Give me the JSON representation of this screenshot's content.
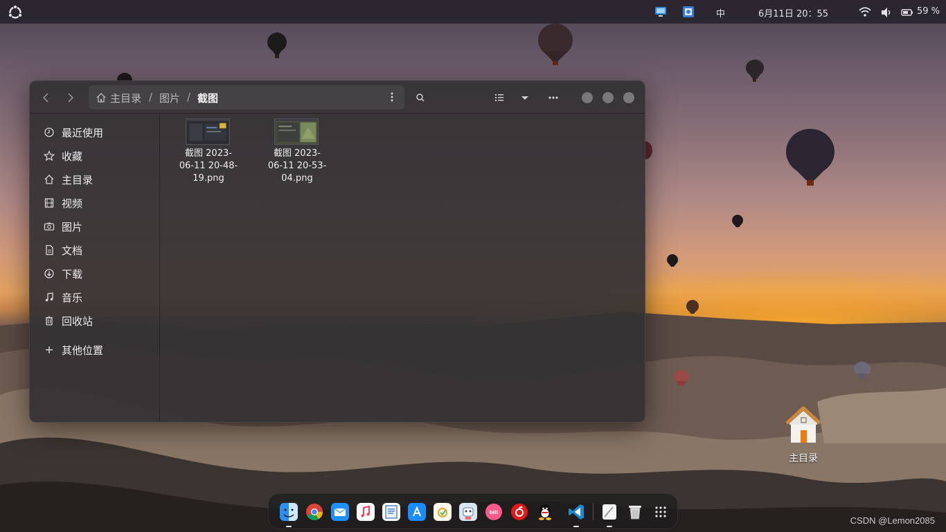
{
  "topbar": {
    "input_method": "中",
    "datetime": "6月11日  20：55",
    "battery": "59 %"
  },
  "window": {
    "path": [
      "主目录",
      "图片",
      "截图"
    ],
    "separators": [
      "/",
      "/"
    ],
    "sidebar": {
      "items": [
        {
          "label": "最近使用",
          "icon": "clock-icon"
        },
        {
          "label": "收藏",
          "icon": "star-icon"
        },
        {
          "label": "主目录",
          "icon": "home-icon"
        },
        {
          "label": "视频",
          "icon": "film-icon"
        },
        {
          "label": "图片",
          "icon": "camera-icon"
        },
        {
          "label": "文档",
          "icon": "document-icon"
        },
        {
          "label": "下载",
          "icon": "download-icon"
        },
        {
          "label": "音乐",
          "icon": "music-icon"
        },
        {
          "label": "回收站",
          "icon": "trash-icon"
        },
        {
          "label": "其他位置",
          "icon": "plus-icon"
        }
      ]
    },
    "files": [
      {
        "name_line1": "截图 2023-",
        "name_line2": "06-11 20-48-",
        "name_line3": "19.png"
      },
      {
        "name_line1": "截图 2023-",
        "name_line2": "06-11 20-53-",
        "name_line3": "04.png"
      }
    ]
  },
  "desktop": {
    "home_label": "主目录"
  },
  "dock": {
    "apps": [
      "finder",
      "chrome",
      "mail",
      "music",
      "text-editor",
      "app-store",
      "notes",
      "qq-robot",
      "bilibili",
      "netease-music",
      "qq",
      "vscode",
      "notepad",
      "trash",
      "app-grid"
    ]
  },
  "watermark": "CSDN @Lemon2085"
}
